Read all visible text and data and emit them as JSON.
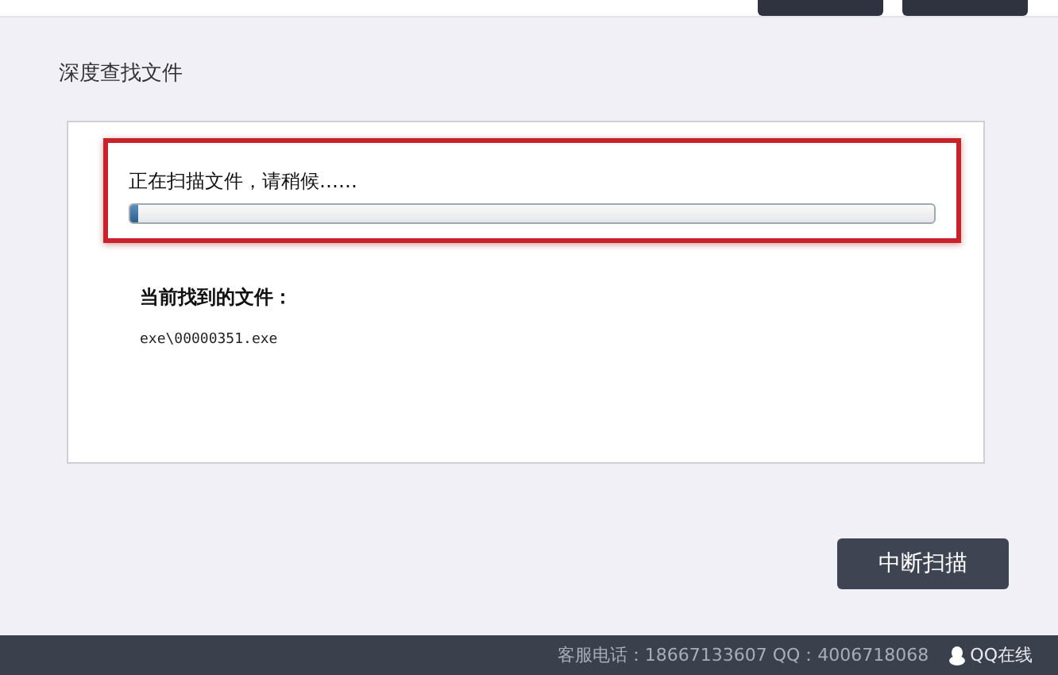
{
  "page": {
    "title": "深度查找文件"
  },
  "scan": {
    "status": "正在扫描文件，请稍候……",
    "progress": {
      "level": 0.01
    },
    "found_label": "当前找到的文件：",
    "found_file": "exe\\00000351.exe"
  },
  "buttons": [
    {
      "label": "中断扫描"
    }
  ],
  "status_bar": {
    "contact": "客服电话：18667133607 QQ：4006718068",
    "qq_online": "QQ在线"
  }
}
